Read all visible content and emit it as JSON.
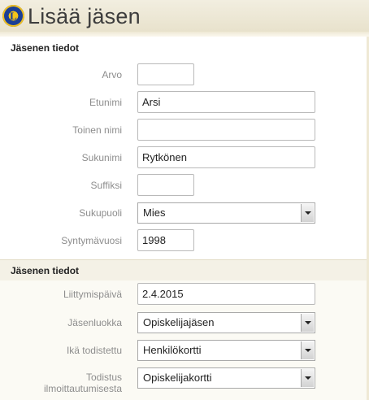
{
  "header": {
    "title": "Lisää jäsen",
    "logo_icon": "lions-club-logo",
    "logo_text": "L"
  },
  "section1": {
    "title": "Jäsenen tiedot",
    "fields": {
      "arvo": {
        "label": "Arvo",
        "value": ""
      },
      "etunimi": {
        "label": "Etunimi",
        "value": "Arsi"
      },
      "toinen_nimi": {
        "label": "Toinen nimi",
        "value": ""
      },
      "sukunimi": {
        "label": "Sukunimi",
        "value": "Rytkönen"
      },
      "suffiksi": {
        "label": "Suffiksi",
        "value": ""
      },
      "sukupuoli": {
        "label": "Sukupuoli",
        "value": "Mies"
      },
      "syntymavuosi": {
        "label": "Syntymävuosi",
        "value": "1998"
      }
    }
  },
  "section2": {
    "title": "Jäsenen tiedot",
    "fields": {
      "liittymispaiva": {
        "label": "Liittymispäivä",
        "value": "2.4.2015"
      },
      "jasenluokka": {
        "label": "Jäsenluokka",
        "value": "Opiskelijajäsen"
      },
      "ika_todistettu": {
        "label": "Ikä todistettu",
        "value": "Henkilökortti"
      },
      "todistus_line1": "Todistus",
      "todistus_line2": "ilmoittautumisesta",
      "todistus_value": "Opiskelijakortti"
    }
  },
  "colors": {
    "header_bg": "#ece6d2",
    "label": "#8d8d8d"
  }
}
